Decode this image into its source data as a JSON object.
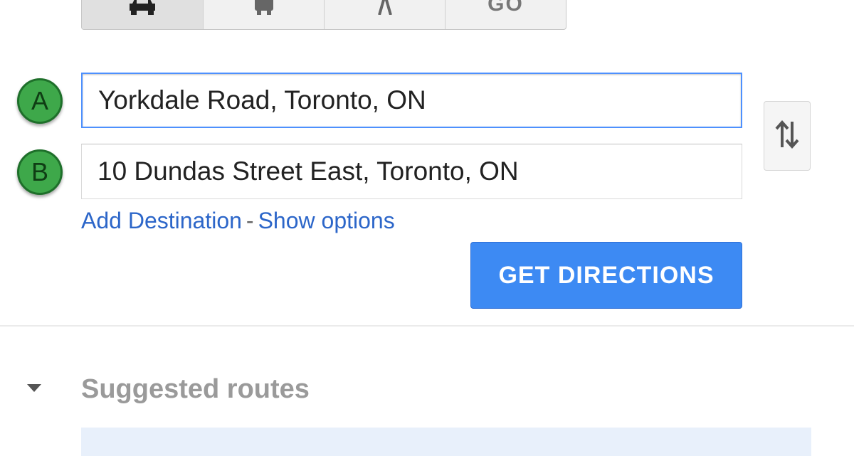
{
  "travel_modes": {
    "items": [
      {
        "name": "car-icon",
        "label": ""
      },
      {
        "name": "transit-icon",
        "label": ""
      },
      {
        "name": "walking-icon",
        "label": ""
      },
      {
        "name": "go-label",
        "label": "GO"
      }
    ],
    "selected": 0
  },
  "waypoints": {
    "a": {
      "marker": "A",
      "value": "Yorkdale Road, Toronto, ON"
    },
    "b": {
      "marker": "B",
      "value": "10 Dundas Street East, Toronto, ON"
    }
  },
  "swap_button": {
    "icon": "swap-arrows-icon"
  },
  "links": {
    "add_destination": "Add Destination",
    "separator": "-",
    "show_options": "Show options"
  },
  "get_directions": {
    "label": "GET DIRECTIONS"
  },
  "suggested_routes": {
    "title": "Suggested routes",
    "collapse_icon": "caret-down-icon"
  },
  "colors": {
    "marker_green": "#3ea84a",
    "button_blue": "#3d8af3",
    "link_blue": "#2c66c9",
    "focus_border": "#4d90fe",
    "route_highlight": "#e8f0fb"
  }
}
